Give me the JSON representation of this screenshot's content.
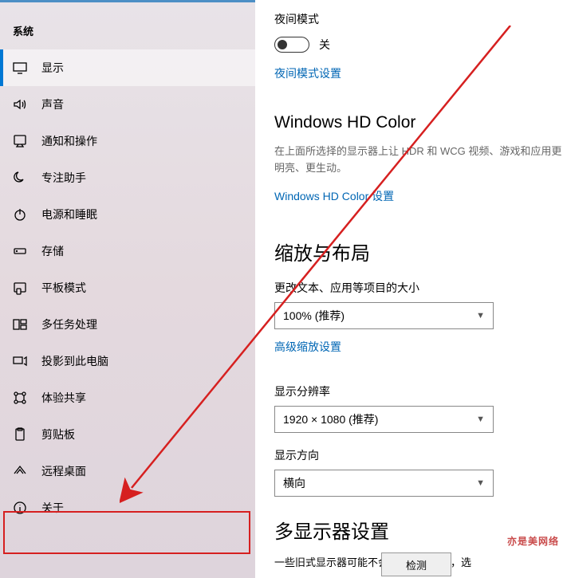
{
  "sidebar": {
    "title": "系统",
    "items": [
      {
        "label": "显示"
      },
      {
        "label": "声音"
      },
      {
        "label": "通知和操作"
      },
      {
        "label": "专注助手"
      },
      {
        "label": "电源和睡眠"
      },
      {
        "label": "存储"
      },
      {
        "label": "平板模式"
      },
      {
        "label": "多任务处理"
      },
      {
        "label": "投影到此电脑"
      },
      {
        "label": "体验共享"
      },
      {
        "label": "剪贴板"
      },
      {
        "label": "远程桌面"
      },
      {
        "label": "关于"
      }
    ]
  },
  "main": {
    "night_mode": {
      "label": "夜间模式",
      "state": "关",
      "link": "夜间模式设置"
    },
    "hd_color": {
      "title": "Windows HD Color",
      "desc": "在上面所选择的显示器上让 HDR 和 WCG 视频、游戏和应用更明亮、更生动。",
      "link": "Windows HD Color 设置"
    },
    "scale_layout": {
      "title": "缩放与布局",
      "text_size_label": "更改文本、应用等项目的大小",
      "text_size_value": "100% (推荐)",
      "advanced_link": "高级缩放设置",
      "resolution_label": "显示分辨率",
      "resolution_value": "1920 × 1080 (推荐)",
      "orientation_label": "显示方向",
      "orientation_value": "横向"
    },
    "multi_display": {
      "title": "多显示器设置",
      "desc": "一些旧式显示器可能不会进行自动连接，选",
      "detect": "检测"
    }
  },
  "watermark": "亦是美网络"
}
